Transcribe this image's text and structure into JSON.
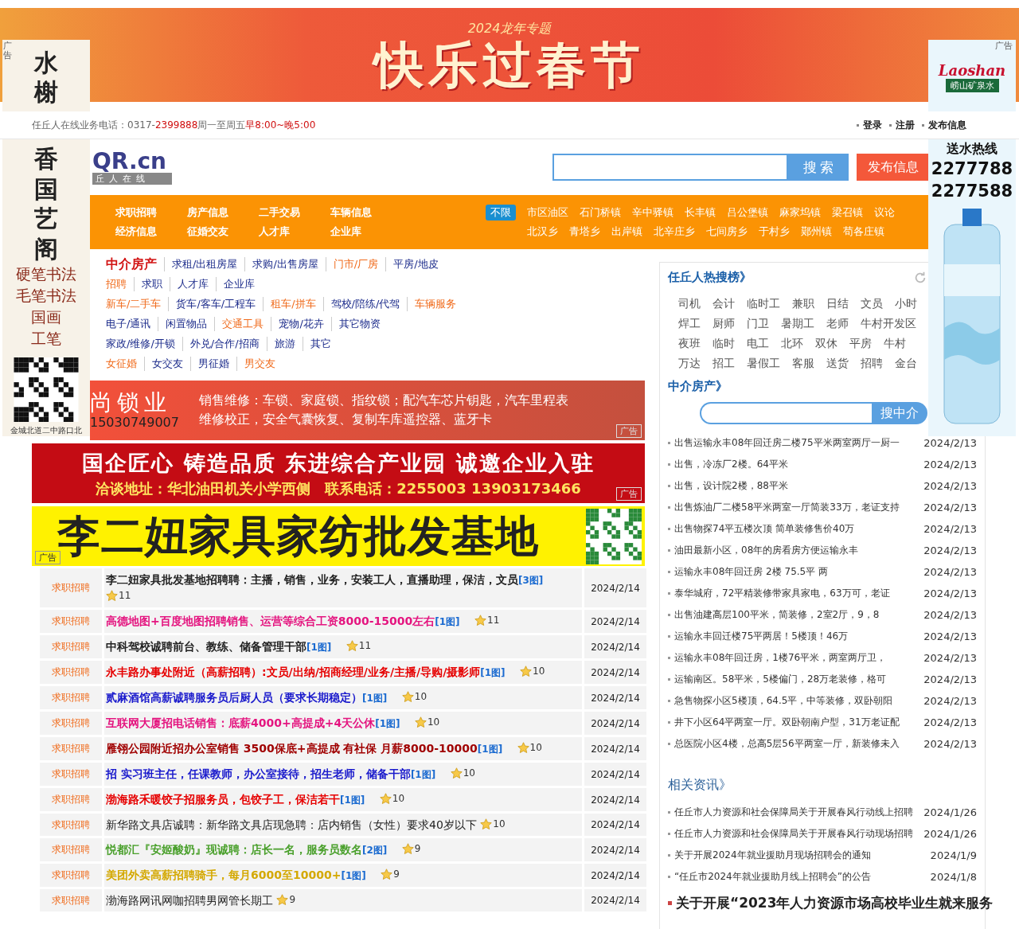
{
  "top_banner": {
    "subtitle": "2024龙年专题",
    "title": "快乐过春节"
  },
  "left_float_ad": {
    "tag": "广告",
    "title_top": "水榭",
    "title_bottom": "香国艺阁",
    "services": [
      "硬笔书法",
      "毛笔书法",
      "国画",
      "工笔"
    ],
    "address": "金城北道二中路口北"
  },
  "right_float_ad": {
    "tag": "广告",
    "brand": "Laoshan",
    "brand_cn": "崂山矿泉水",
    "hotline_label": "送水热线",
    "phones": [
      "2277788",
      "2277588"
    ]
  },
  "info_bar": {
    "label": "任丘人在线业务电话：0317-",
    "phone": "2399888",
    "days": "周一至周五",
    "hours": "早8:00~晚5:00",
    "links": [
      "登录",
      "注册",
      "发布信息"
    ]
  },
  "header": {
    "logo": "QR.cn",
    "logo_sub": "丘人在线",
    "search_button": "搜 索",
    "post_button": "发布信息"
  },
  "nav": {
    "menu": [
      "求职招聘",
      "房产信息",
      "二手交易",
      "车辆信息",
      "经济信息",
      "征婚交友",
      "人才库",
      "企业库"
    ],
    "area_rows": [
      [
        {
          "label": "不限",
          "selected": true
        },
        {
          "label": "市区油区",
          "selected": false
        },
        {
          "label": "石门桥镇",
          "selected": false
        },
        {
          "label": "辛中驿镇",
          "selected": false
        },
        {
          "label": "长丰镇",
          "selected": false
        },
        {
          "label": "吕公堡镇",
          "selected": false
        },
        {
          "label": "麻家坞镇",
          "selected": false
        },
        {
          "label": "梁召镇",
          "selected": false
        },
        {
          "label": "议论",
          "selected": false
        }
      ],
      [
        {
          "label": "北汉乡",
          "selected": false
        },
        {
          "label": "青塔乡",
          "selected": false
        },
        {
          "label": "出岸镇",
          "selected": false
        },
        {
          "label": "北辛庄乡",
          "selected": false
        },
        {
          "label": "七间房乡",
          "selected": false
        },
        {
          "label": "于村乡",
          "selected": false
        },
        {
          "label": "鄚州镇",
          "selected": false
        },
        {
          "label": "苟各庄镇",
          "selected": false
        }
      ]
    ]
  },
  "categories": [
    [
      {
        "label": "中介房产",
        "kind": "hot"
      },
      {
        "label": "求租/出租房屋",
        "kind": "normal"
      },
      {
        "label": "求购/出售房屋",
        "kind": "normal"
      },
      {
        "label": "门市/厂房",
        "kind": "orange"
      },
      {
        "label": "平房/地皮",
        "kind": "normal"
      }
    ],
    [
      {
        "label": "招聘",
        "kind": "orange"
      },
      {
        "label": "求职",
        "kind": "normal"
      },
      {
        "label": "人才库",
        "kind": "normal"
      },
      {
        "label": "企业库",
        "kind": "normal"
      }
    ],
    [
      {
        "label": "新车/二手车",
        "kind": "orange"
      },
      {
        "label": "货车/客车/工程车",
        "kind": "normal"
      },
      {
        "label": "租车/拼车",
        "kind": "orange"
      },
      {
        "label": "驾校/陪练/代驾",
        "kind": "normal"
      },
      {
        "label": "车辆服务",
        "kind": "orange"
      }
    ],
    [
      {
        "label": "电子/通讯",
        "kind": "normal"
      },
      {
        "label": "闲置物品",
        "kind": "normal"
      },
      {
        "label": "交通工具",
        "kind": "orange"
      },
      {
        "label": "宠物/花卉",
        "kind": "normal"
      },
      {
        "label": "其它物资",
        "kind": "normal"
      }
    ],
    [
      {
        "label": "家政/维修/开锁",
        "kind": "normal"
      },
      {
        "label": "外兑/合作/招商",
        "kind": "normal"
      },
      {
        "label": "旅游",
        "kind": "normal"
      },
      {
        "label": "其它",
        "kind": "normal"
      }
    ],
    [
      {
        "label": "女征婚",
        "kind": "orange"
      },
      {
        "label": "女交友",
        "kind": "normal"
      },
      {
        "label": "男征婚",
        "kind": "normal"
      },
      {
        "label": "男交友",
        "kind": "orange"
      }
    ]
  ],
  "ads": {
    "lock": {
      "name": "尚锁业",
      "phone": "15030749007",
      "lines": [
        "销售维修：车锁、家庭锁、指纹锁；配汽车芯片钥匙，汽车里程表",
        "维修校正，安全气囊恢复、复制车库遥控器、蓝牙卡"
      ],
      "tag": "广告"
    },
    "park": {
      "headline": "国企匠心 铸造品质 东进综合产业园 诚邀企业入驻",
      "contact": "洽谈地址：华北油田机关小学西侧　联系电话：2255003 13903173466",
      "tag": "广告"
    },
    "furniture": {
      "title": "李二妞家具家纺批发基地",
      "tag": "广告"
    }
  },
  "jobs": [
    {
      "category": "求职招聘",
      "title": "李二妞家具批发基地招聘聘：主播，销售，业务，安装工人，直播助理，保洁，文员",
      "pics": "[3图]",
      "hits": "11",
      "date": "2024/2/14",
      "color": "#222222",
      "bold": true
    },
    {
      "category": "求职招聘",
      "title": "高德地图+百度地图招聘销售、运营等综合工资8000-15000左右",
      "pics": "[1图]",
      "hits": "11",
      "date": "2024/2/14",
      "color": "#e4147f",
      "bold": true
    },
    {
      "category": "求职招聘",
      "title": "中科驾校诚聘前台、教练、储备管理干部",
      "pics": "[1图]",
      "hits": "11",
      "date": "2024/2/14",
      "color": "#222222",
      "bold": true
    },
    {
      "category": "求职招聘",
      "title": "永丰路办事处附近（高薪招聘）:文员/出纳/招商经理/业务/主播/导购/摄影师",
      "pics": "[1图]",
      "hits": "10",
      "date": "2024/2/14",
      "color": "#e60000",
      "bold": true
    },
    {
      "category": "求职招聘",
      "title": "贰麻酒馆高薪诚聘服务员后厨人员（要求长期稳定）",
      "pics": "[1图]",
      "hits": "10",
      "date": "2024/2/14",
      "color": "#1a1acc",
      "bold": true
    },
    {
      "category": "求职招聘",
      "title": "互联网大厦招电话销售：底薪4000+高提成+4天公休",
      "pics": "[1图]",
      "hits": "10",
      "date": "2024/2/14",
      "color": "#e4147f",
      "bold": true
    },
    {
      "category": "求职招聘",
      "title": "雁翎公园附近招办公室销售 3500保底+高提成 有社保 月薪8000-10000",
      "pics": "[1图]",
      "hits": "10",
      "date": "2024/2/14",
      "color": "#a00000",
      "bold": true
    },
    {
      "category": "求职招聘",
      "title": "招 实习班主任，任课教师，办公室接待，招生老师，储备干部",
      "pics": "[1图]",
      "hits": "10",
      "date": "2024/2/14",
      "color": "#1a1acc",
      "bold": true
    },
    {
      "category": "求职招聘",
      "title": "渤海路禾暖饺子招服务员，包饺子工，保洁若干",
      "pics": "[1图]",
      "hits": "10",
      "date": "2024/2/14",
      "color": "#e60000",
      "bold": true
    },
    {
      "category": "求职招聘",
      "title": "新华路文具店诚聘：新华路文具店现急聘：店内销售（女性）要求40岁以下",
      "hits": "10",
      "date": "2024/2/14",
      "color": "#222222",
      "bold": false
    },
    {
      "category": "求职招聘",
      "title": "悦都汇『安姬酸奶』现诚聘：店长一名，服务员数名",
      "pics": "[2图]",
      "hits": "9",
      "date": "2024/2/14",
      "color": "#4aa02c",
      "bold": true
    },
    {
      "category": "求职招聘",
      "title": "美团外卖高薪招聘骑手，每月6000至10000+",
      "pics": "[1图]",
      "hits": "9",
      "date": "2024/2/14",
      "color": "#d4a800",
      "bold": true
    },
    {
      "category": "求职招聘",
      "title": "渤海路网讯网咖招聘男网管长期工",
      "hits": "9",
      "date": "2024/2/14",
      "color": "#222222",
      "bold": false
    }
  ],
  "hot_search": {
    "title": "任丘人热搜榜》",
    "rows": [
      [
        "司机",
        "会计",
        "临时工",
        "兼职",
        "日结",
        "文员",
        "小时"
      ],
      [
        "焊工",
        "厨师",
        "门卫",
        "暑期工",
        "老师",
        "牛村开发区"
      ],
      [
        "夜班",
        "临时",
        "电工",
        "北环",
        "双休",
        "平房",
        "牛村"
      ],
      [
        "万达",
        "招工",
        "暑假工",
        "客服",
        "送货",
        "招聘",
        "金台"
      ]
    ]
  },
  "house": {
    "title": "中介房产》",
    "search_button": "搜中介",
    "items": [
      {
        "text": "出售运输永丰08年回迁房二楼75平米两室两厅一厨一",
        "date": "2024/2/13"
      },
      {
        "text": "出售，冷冻厂2楼。64平米",
        "date": "2024/2/13"
      },
      {
        "text": "出售，设计院2楼，88平米",
        "date": "2024/2/13"
      },
      {
        "text": "出售炼油厂二楼58平米两室一厅简装33万，老证支持",
        "date": "2024/2/13"
      },
      {
        "text": "出售物探74平五楼次顶 简单装修售价40万",
        "date": "2024/2/13"
      },
      {
        "text": "油田最新小区，08年的房看房方便运输永丰",
        "date": "2024/2/13"
      },
      {
        "text": "运输永丰08年回迁房 2楼 75.5平 两",
        "date": "2024/2/13"
      },
      {
        "text": "泰华城府，72平精装修带家具家电，63万可，老证",
        "date": "2024/2/13"
      },
      {
        "text": "出售油建高层100平米，简装修，2室2厅，9，8",
        "date": "2024/2/13"
      },
      {
        "text": "运输永丰回迁楼75平两居！5楼顶！46万",
        "date": "2024/2/13"
      },
      {
        "text": "运输永丰08年回迁房，1楼76平米，两室两厅卫，",
        "date": "2024/2/13"
      },
      {
        "text": "运输南区。58平米，5楼偏门，28万老装修，格可",
        "date": "2024/2/13"
      },
      {
        "text": "急售物探小区5楼顶，64.5平，中等装修，双卧朝阳",
        "date": "2024/2/13"
      },
      {
        "text": "井下小区64平两室一厅。双卧朝南户型，31万老证配",
        "date": "2024/2/13"
      },
      {
        "text": "总医院小区4楼，总高5层56平两室一厅，新装修未入",
        "date": "2024/2/13"
      }
    ]
  },
  "news": {
    "title": "相关资讯》",
    "items": [
      {
        "text": "任丘市人力资源和社会保障局关于开展春风行动线上招聘",
        "date": "2024/1/26"
      },
      {
        "text": "任丘市人力资源和社会保障局关于开展春风行动现场招聘",
        "date": "2024/1/26"
      },
      {
        "text": "关于开展2024年就业援助月现场招聘会的通知",
        "date": "2024/1/9"
      },
      {
        "text": "“任丘市2024年就业援助月线上招聘会”的公告",
        "date": "2024/1/8"
      }
    ],
    "headline": "关于开展“2023年人力资源市场高校毕业生就来服务"
  }
}
